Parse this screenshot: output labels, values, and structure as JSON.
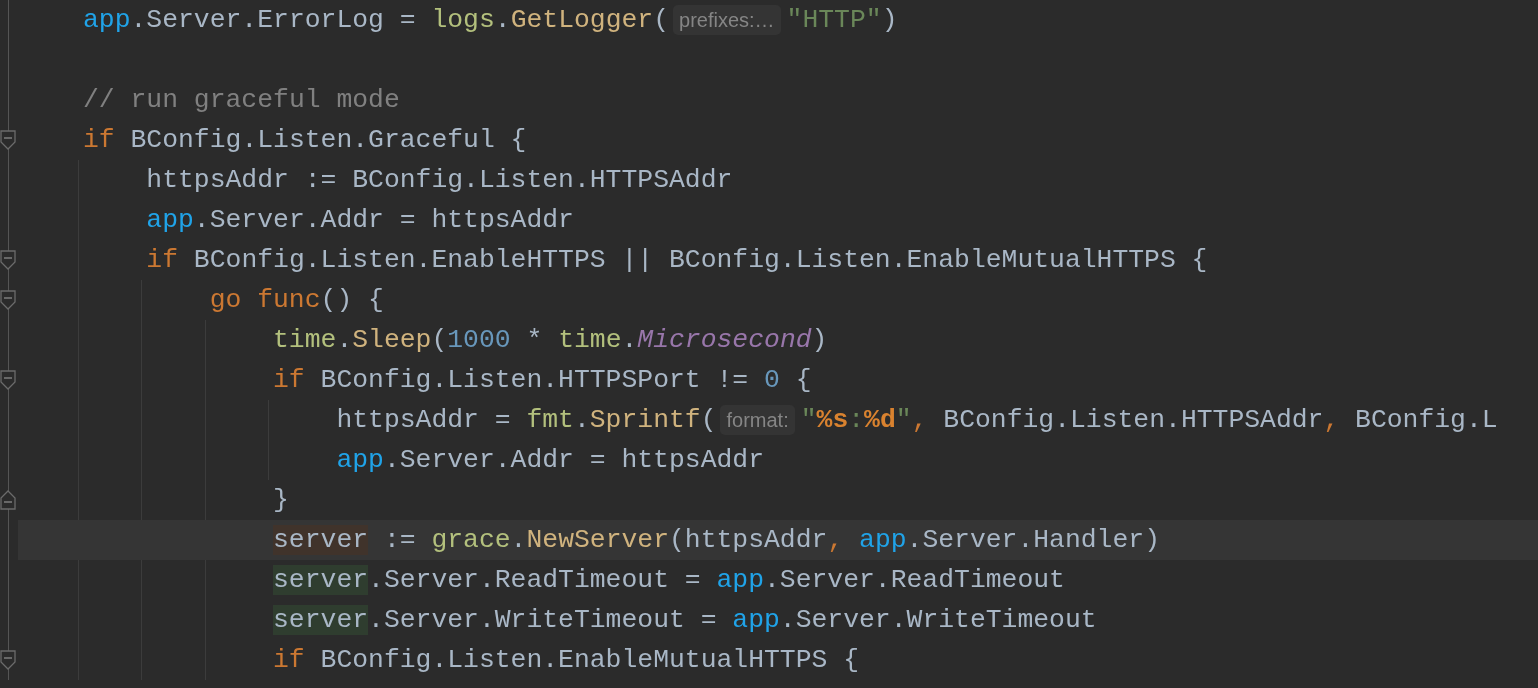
{
  "editor": {
    "lines": [
      {
        "kind": "plain",
        "tokens": [
          {
            "kind": "global",
            "text": "app"
          },
          {
            "kind": "plain",
            "text": ".Server.ErrorLog = "
          },
          {
            "kind": "package",
            "text": "logs"
          },
          {
            "kind": "plain",
            "text": "."
          },
          {
            "kind": "func",
            "text": "GetLogger"
          },
          {
            "kind": "plain",
            "text": "("
          },
          {
            "kind": "hint",
            "text": "prefixes:…"
          },
          {
            "kind": "string",
            "text": "\"HTTP\""
          },
          {
            "kind": "plain",
            "text": ")"
          }
        ]
      },
      {
        "kind": "plain"
      },
      {
        "kind": "plain",
        "tokens": [
          {
            "kind": "comment",
            "text": "// run graceful mode"
          }
        ]
      },
      {
        "kind": "opener",
        "tokens": [
          {
            "kind": "keyword",
            "text": "if"
          },
          {
            "kind": "plain",
            "text": " BConfig.Listen.Graceful {"
          }
        ],
        "children": [
          {
            "kind": "plain",
            "tokens": [
              {
                "kind": "plain",
                "text": "httpsAddr := BConfig.Listen.HTTPSAddr"
              }
            ]
          },
          {
            "kind": "plain",
            "tokens": [
              {
                "kind": "global",
                "text": "app"
              },
              {
                "kind": "plain",
                "text": ".Server.Addr = httpsAddr"
              }
            ]
          },
          {
            "kind": "opener",
            "tokens": [
              {
                "kind": "keyword",
                "text": "if"
              },
              {
                "kind": "plain",
                "text": " BConfig.Listen.EnableHTTPS || BConfig.Listen.EnableMutualHTTPS {"
              }
            ],
            "children": [
              {
                "kind": "opener",
                "tokens": [
                  {
                    "kind": "keyword",
                    "text": "go func"
                  },
                  {
                    "kind": "plain",
                    "text": "() {"
                  }
                ],
                "children": [
                  {
                    "kind": "plain",
                    "tokens": [
                      {
                        "kind": "package",
                        "text": "time"
                      },
                      {
                        "kind": "plain",
                        "text": "."
                      },
                      {
                        "kind": "func",
                        "text": "Sleep"
                      },
                      {
                        "kind": "plain",
                        "text": "("
                      },
                      {
                        "kind": "number",
                        "text": "1000"
                      },
                      {
                        "kind": "plain",
                        "text": " * "
                      },
                      {
                        "kind": "package",
                        "text": "time"
                      },
                      {
                        "kind": "plain",
                        "text": "."
                      },
                      {
                        "kind": "constant",
                        "text": "Microsecond"
                      },
                      {
                        "kind": "plain",
                        "text": ")"
                      }
                    ]
                  },
                  {
                    "kind": "opener",
                    "tokens": [
                      {
                        "kind": "keyword",
                        "text": "if"
                      },
                      {
                        "kind": "plain",
                        "text": " BConfig.Listen.HTTPSPort != "
                      },
                      {
                        "kind": "number",
                        "text": "0"
                      },
                      {
                        "kind": "plain",
                        "text": " {"
                      }
                    ],
                    "children": [
                      {
                        "kind": "plain",
                        "tokens": [
                          {
                            "kind": "plain",
                            "text": "httpsAddr = "
                          },
                          {
                            "kind": "package",
                            "text": "fmt"
                          },
                          {
                            "kind": "plain",
                            "text": "."
                          },
                          {
                            "kind": "func",
                            "text": "Sprintf"
                          },
                          {
                            "kind": "plain",
                            "text": "("
                          },
                          {
                            "kind": "hint",
                            "text": "format:"
                          },
                          {
                            "kind": "string",
                            "text": "\""
                          },
                          {
                            "kind": "format",
                            "text": "%s"
                          },
                          {
                            "kind": "string",
                            "text": ":"
                          },
                          {
                            "kind": "format",
                            "text": "%d"
                          },
                          {
                            "kind": "string",
                            "text": "\""
                          },
                          {
                            "kind": "punct",
                            "text": ","
                          },
                          {
                            "kind": "plain",
                            "text": " BConfig.Listen.HTTPSAddr"
                          },
                          {
                            "kind": "punct",
                            "text": ","
                          },
                          {
                            "kind": "plain",
                            "text": " BConfig.L"
                          }
                        ]
                      },
                      {
                        "kind": "plain",
                        "tokens": [
                          {
                            "kind": "global",
                            "text": "app"
                          },
                          {
                            "kind": "plain",
                            "text": ".Server.Addr = httpsAddr"
                          }
                        ]
                      }
                    ]
                  },
                  {
                    "kind": "closer",
                    "tokens": [
                      {
                        "kind": "plain",
                        "text": "}"
                      }
                    ]
                  },
                  {
                    "kind": "current",
                    "tokens": [
                      {
                        "kind": "written",
                        "text": "server"
                      },
                      {
                        "kind": "plain",
                        "text": " := "
                      },
                      {
                        "kind": "package",
                        "text": "grace"
                      },
                      {
                        "kind": "plain",
                        "text": "."
                      },
                      {
                        "kind": "func",
                        "text": "NewServer"
                      },
                      {
                        "kind": "plain",
                        "text": "(httpsAddr"
                      },
                      {
                        "kind": "punct",
                        "text": ", "
                      },
                      {
                        "kind": "global",
                        "text": "app"
                      },
                      {
                        "kind": "plain",
                        "text": ".Server.Handler)"
                      }
                    ]
                  },
                  {
                    "kind": "plain",
                    "tokens": [
                      {
                        "kind": "read",
                        "text": "server"
                      },
                      {
                        "kind": "plain",
                        "text": ".Server.ReadTimeout = "
                      },
                      {
                        "kind": "global",
                        "text": "app"
                      },
                      {
                        "kind": "plain",
                        "text": ".Server.ReadTimeout"
                      }
                    ]
                  },
                  {
                    "kind": "plain",
                    "tokens": [
                      {
                        "kind": "read",
                        "text": "server"
                      },
                      {
                        "kind": "plain",
                        "text": ".Server.WriteTimeout = "
                      },
                      {
                        "kind": "global",
                        "text": "app"
                      },
                      {
                        "kind": "plain",
                        "text": ".Server.WriteTimeout"
                      }
                    ]
                  },
                  {
                    "kind": "opener",
                    "tokens": [
                      {
                        "kind": "keyword",
                        "text": "if"
                      },
                      {
                        "kind": "plain",
                        "text": " BConfig.Listen.EnableMutualHTTPS {"
                      }
                    ]
                  }
                ]
              }
            ]
          }
        ]
      }
    ]
  }
}
